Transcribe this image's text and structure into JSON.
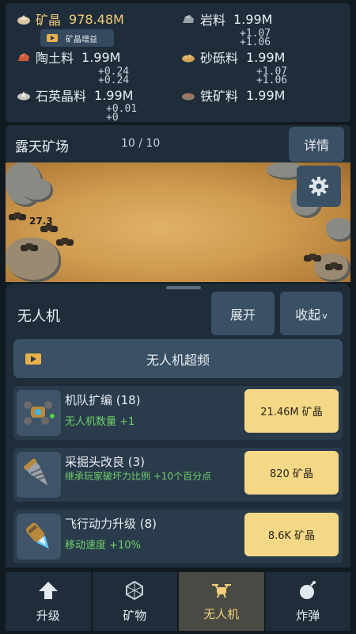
{
  "resources": [
    {
      "name": "矿晶",
      "value": "978.48M",
      "icon": "crystal-icon",
      "color": "#f2cc7a"
    },
    {
      "name": "岩料",
      "value": "1.99M",
      "icon": "rock-icon",
      "delta": [
        "+1.07",
        "+1.06"
      ]
    },
    {
      "name": "陶土料",
      "value": "1.99M",
      "icon": "clay-icon",
      "delta": [
        "+0.24",
        "+0.24"
      ]
    },
    {
      "name": "砂砾料",
      "value": "1.99M",
      "icon": "gravel-icon",
      "delta": [
        "+1.07",
        "+1.06"
      ]
    },
    {
      "name": "石英晶料",
      "value": "1.99M",
      "icon": "quartz-icon",
      "delta": [
        "+0.01",
        "+0"
      ]
    },
    {
      "name": "铁矿料",
      "value": "1.99M",
      "icon": "iron-ore-icon"
    }
  ],
  "boost_label": "矿晶增益",
  "mine": {
    "title": "露天矿场",
    "count": "10 / 10",
    "detail_label": "详情",
    "scene_number": "27.3"
  },
  "drone_panel": {
    "title": "无人机",
    "expand_label": "展开",
    "collapse_label": "收起",
    "collapse_arrow": "v",
    "overclock_label": "无人机超频",
    "upgrades": [
      {
        "title": "机队扩编 (18)",
        "desc": "无人机数量 +1",
        "price": "21.46M 矿晶",
        "icon": "drone-squad-icon"
      },
      {
        "title": "采掘头改良 (3)",
        "desc": "继承玩家破坏力比例 +10个百分点",
        "price": "820 矿晶",
        "icon": "drill-head-icon"
      },
      {
        "title": "飞行动力升级 (8)",
        "desc": "移动速度 +10%",
        "price": "8.6K 矿晶",
        "icon": "thruster-icon"
      }
    ]
  },
  "nav": [
    {
      "label": "升级",
      "icon": "up-arrow-icon",
      "active": false
    },
    {
      "label": "矿物",
      "icon": "mineral-icon",
      "active": false
    },
    {
      "label": "无人机",
      "icon": "drone-icon",
      "active": true
    },
    {
      "label": "炸弹",
      "icon": "bomb-icon",
      "active": false
    }
  ],
  "colors": {
    "accent": "#f5d886",
    "panel": "#1f2d3a",
    "button": "#3a5064",
    "positive": "#6fcf6a"
  }
}
